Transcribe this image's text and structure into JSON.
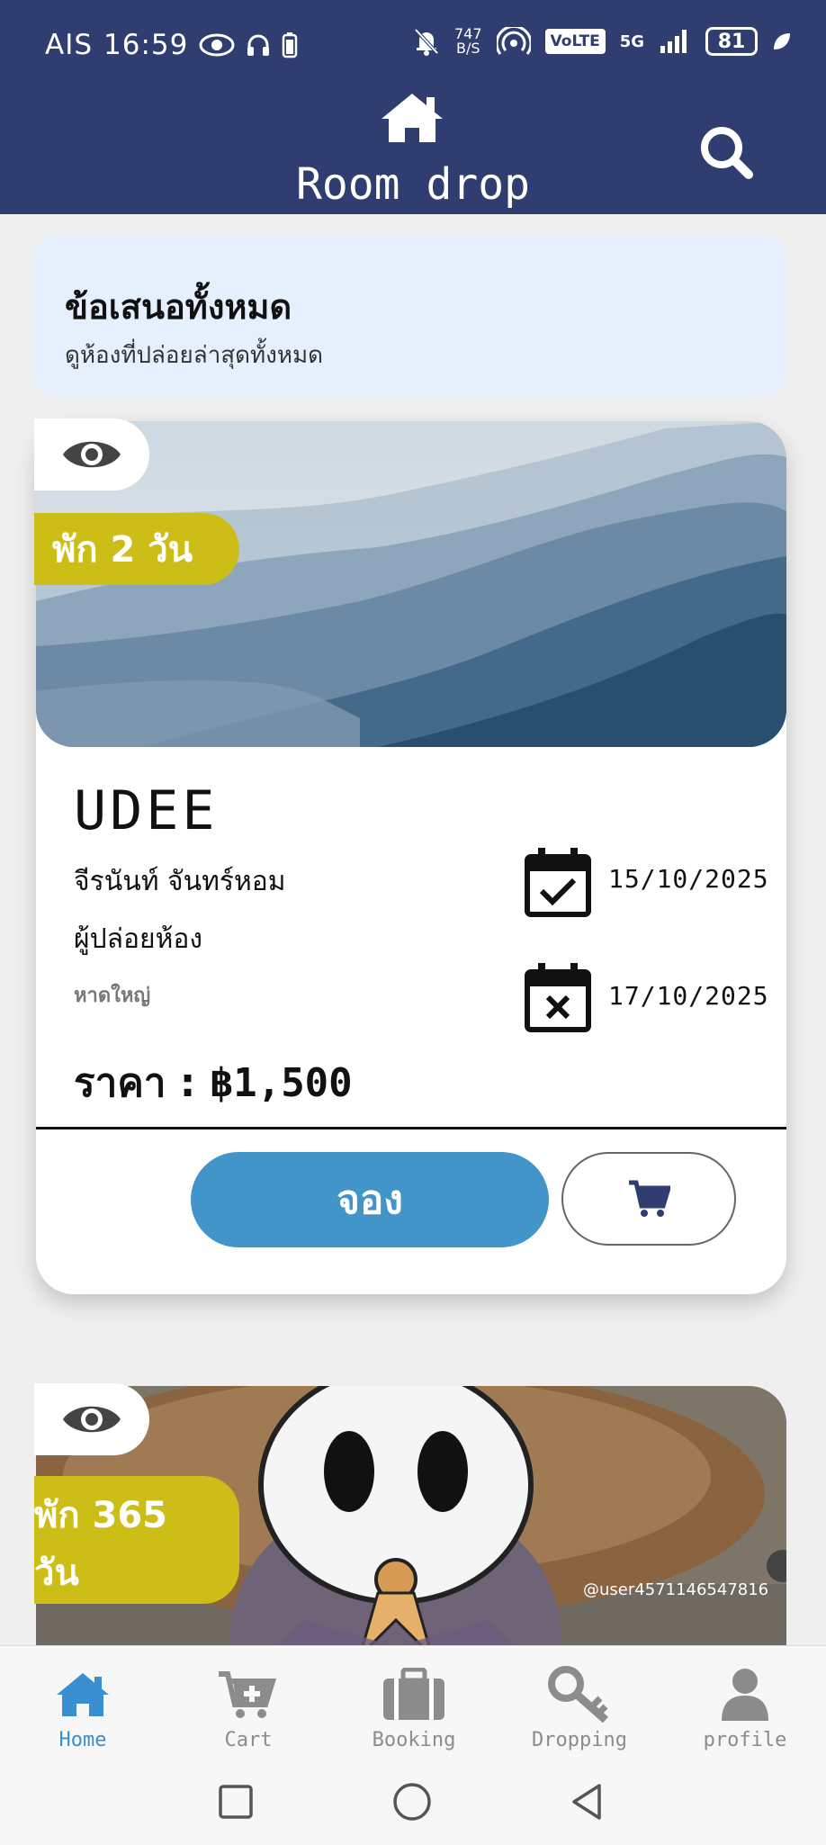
{
  "status_bar": {
    "carrier": "AIS",
    "time": "16:59",
    "net_speed_value": "747",
    "net_speed_unit": "B/S",
    "volte": "VoLTE",
    "network": "5G",
    "battery": "81"
  },
  "header": {
    "title": "Room drop",
    "home_icon": "home-icon",
    "search_icon": "search-icon"
  },
  "banner": {
    "title": "ข้อเสนอทั้งหมด",
    "subtitle": "ดูห้องที่ปล่อยล่าสุดทั้งหมด"
  },
  "cards": [
    {
      "stay_label": "พัก 2 วัน",
      "hotel_name": "UDEE",
      "owner_name": "จีรนันท์ จันทร์หอม",
      "owner_role": "ผู้ปล่อยห้อง",
      "location": "หาดใหญ่",
      "checkin_date": "15/10/2025",
      "checkout_date": "17/10/2025",
      "price_label": "ราคา : ",
      "price_value": "฿1,500",
      "book_label": "จอง"
    },
    {
      "stay_label_line1": "พัก 365",
      "stay_label_line2": "วัน",
      "watermark": "@user4571146547816"
    }
  ],
  "bottom_nav": {
    "items": [
      {
        "label": "Home",
        "icon": "home-icon",
        "active": true
      },
      {
        "label": "Cart",
        "icon": "cart-plus-icon",
        "active": false
      },
      {
        "label": "Booking",
        "icon": "suitcase-icon",
        "active": false
      },
      {
        "label": "Dropping",
        "icon": "key-icon",
        "active": false
      },
      {
        "label": "profile",
        "icon": "user-icon",
        "active": false
      }
    ]
  },
  "colors": {
    "header_bg": "#2f3d70",
    "stay_badge": "#cdbd17",
    "book_button": "#4195c8",
    "active_nav": "#3a8fd0"
  }
}
